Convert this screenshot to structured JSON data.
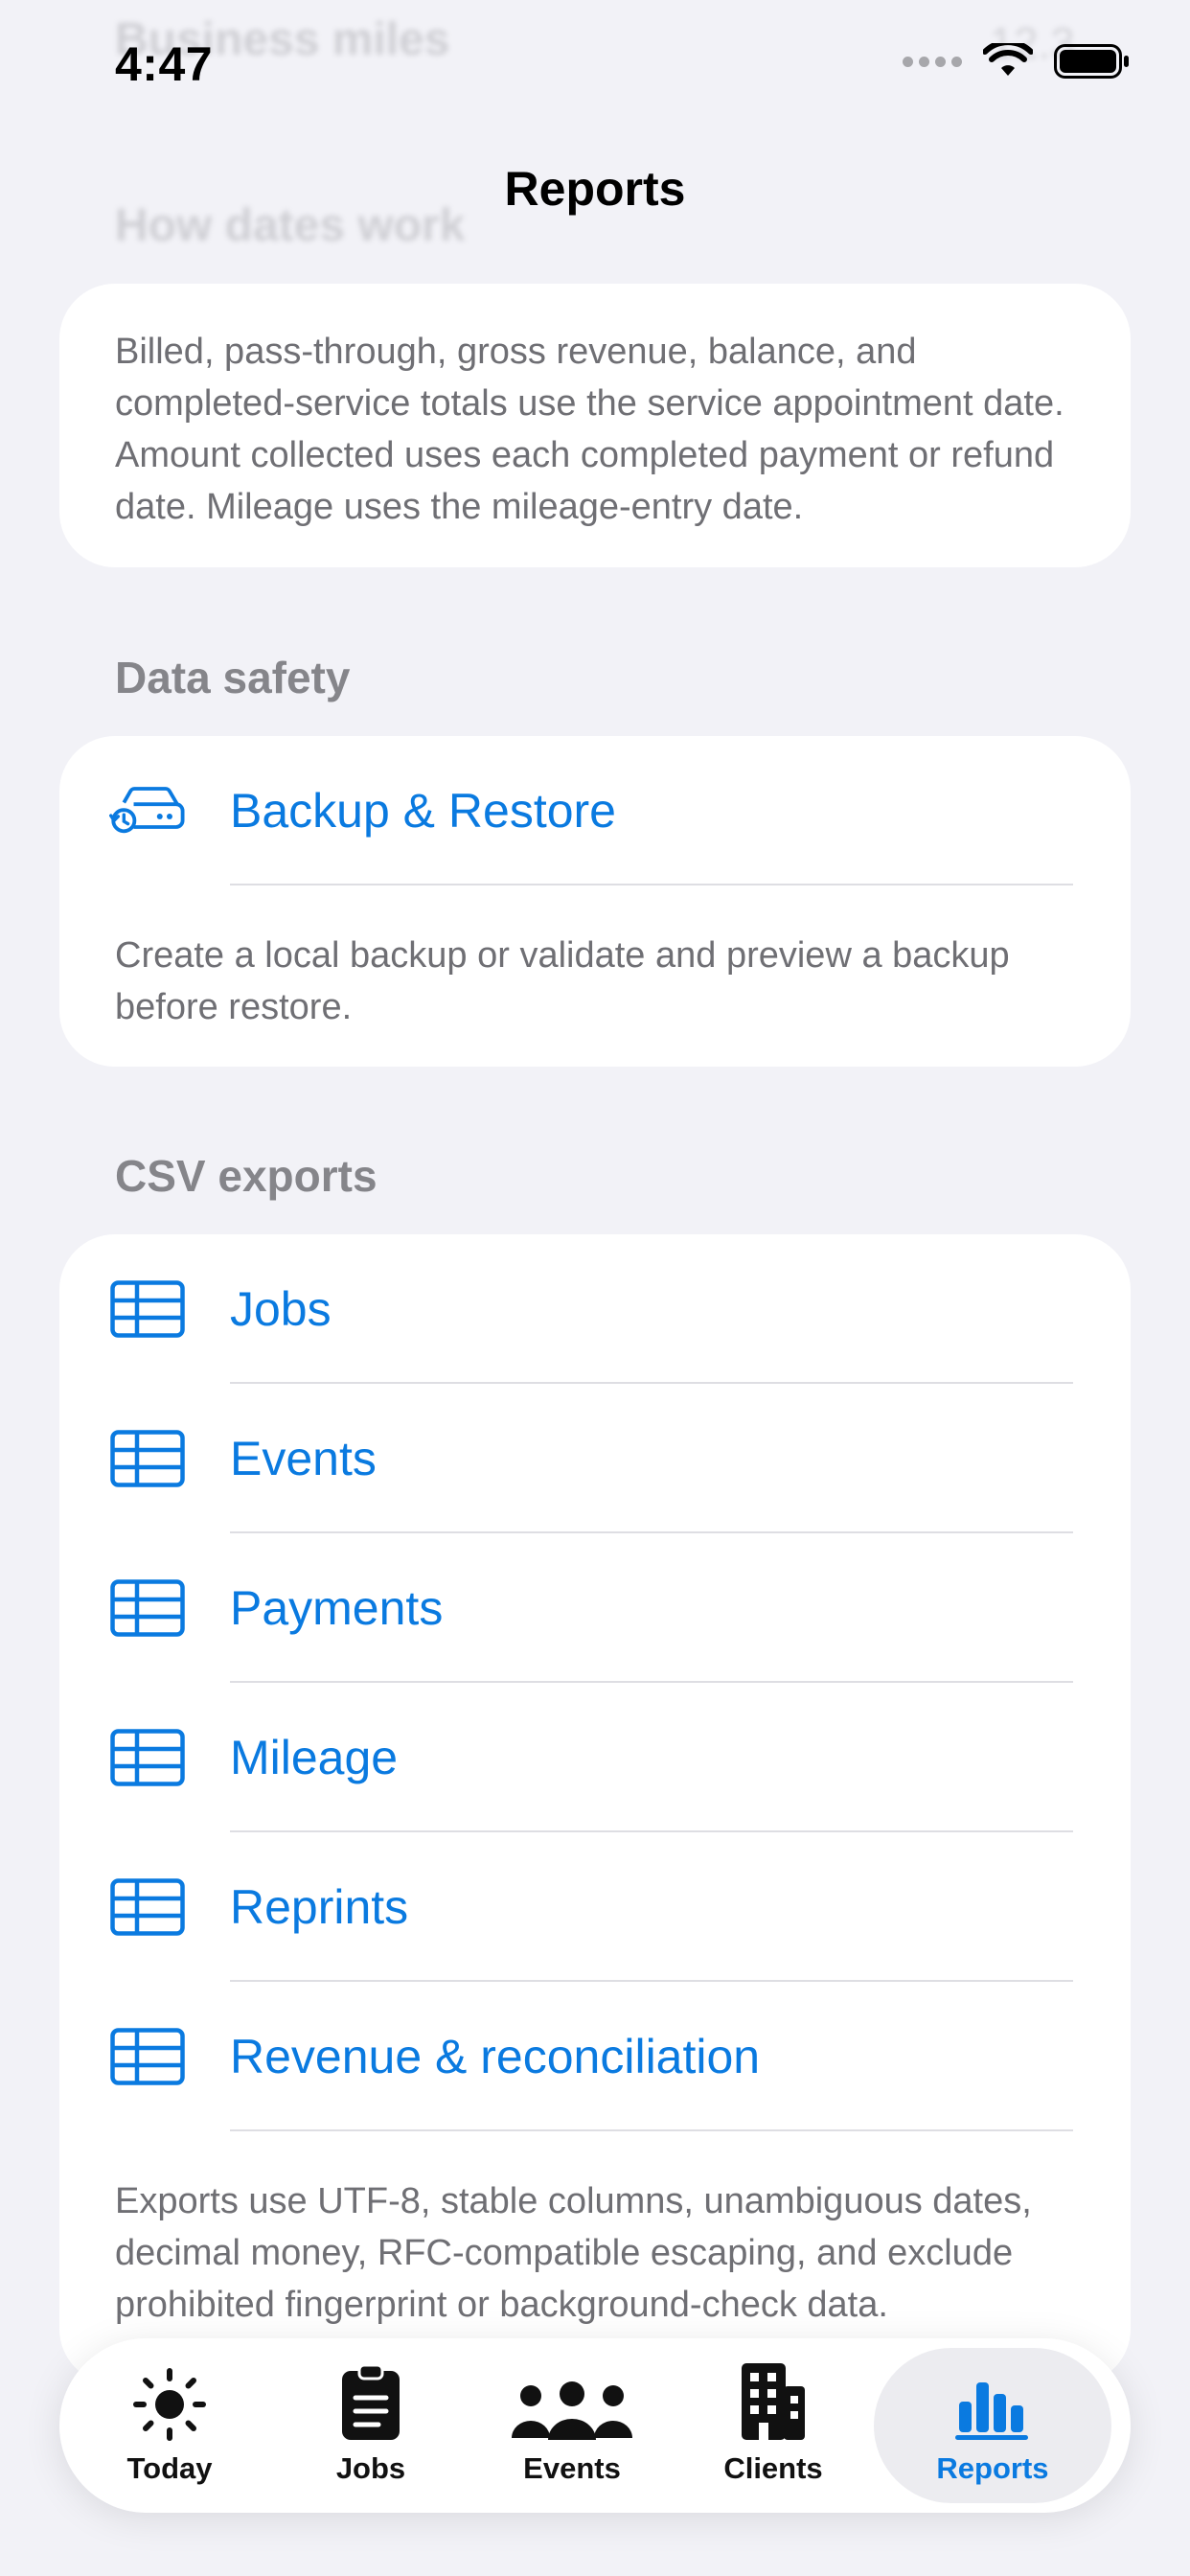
{
  "status": {
    "time": "4:47"
  },
  "ghost": {
    "top_row_label": "Business miles",
    "top_row_value": "12.3",
    "how_dates_header": "How dates work"
  },
  "nav": {
    "title": "Reports"
  },
  "how_dates": {
    "note": "Billed, pass-through, gross revenue, balance, and completed-service totals use the service appointment date. Amount collected uses each completed payment or refund date. Mileage uses the mileage-entry date."
  },
  "data_safety": {
    "header": "Data safety",
    "backup_label": "Backup & Restore",
    "backup_icon": "backup-restore-icon",
    "note": "Create a local backup or validate and preview a backup before restore."
  },
  "csv_exports": {
    "header": "CSV exports",
    "items": [
      {
        "label": "Jobs",
        "icon": "table-icon"
      },
      {
        "label": "Events",
        "icon": "table-icon"
      },
      {
        "label": "Payments",
        "icon": "table-icon"
      },
      {
        "label": "Mileage",
        "icon": "table-icon"
      },
      {
        "label": "Reprints",
        "icon": "table-icon"
      },
      {
        "label": "Revenue & reconciliation",
        "icon": "table-icon"
      }
    ],
    "note": "Exports use UTF-8, stable columns, unambiguous dates, decimal money, RFC-compatible escaping, and exclude prohibited fingerprint or background-check data."
  },
  "tabs": [
    {
      "label": "Today",
      "icon": "sun-icon",
      "active": false
    },
    {
      "label": "Jobs",
      "icon": "clipboard-icon",
      "active": false
    },
    {
      "label": "Events",
      "icon": "people-icon",
      "active": false
    },
    {
      "label": "Clients",
      "icon": "building-icon",
      "active": false
    },
    {
      "label": "Reports",
      "icon": "bar-chart-icon",
      "active": true
    }
  ],
  "colors": {
    "accent": "#0a7ae0",
    "background": "#f2f2f7",
    "secondary_text": "#6f6f74",
    "header_text": "#85858a"
  }
}
